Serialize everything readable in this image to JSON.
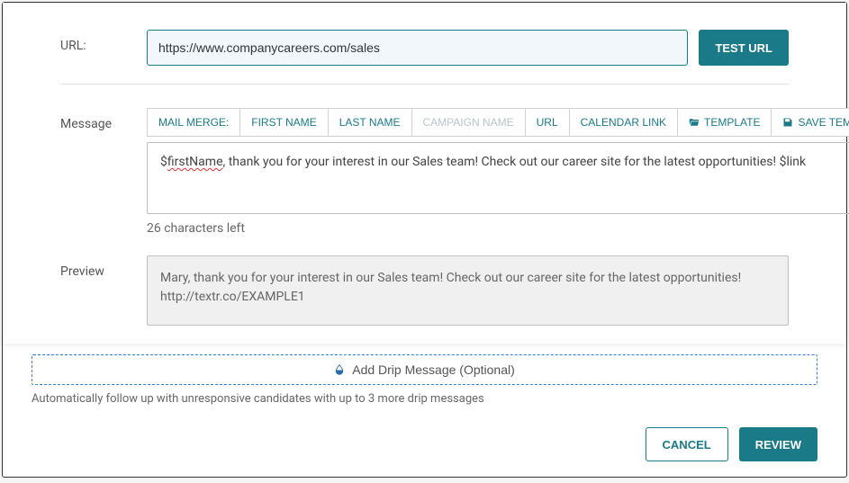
{
  "url": {
    "label": "URL:",
    "value": "https://www.companycareers.com/sales",
    "test_label": "TEST URL"
  },
  "message": {
    "label": "Message",
    "toolbar": {
      "mail_merge": "MAIL MERGE:",
      "first_name": "FIRST NAME",
      "last_name": "LAST NAME",
      "campaign_name": "CAMPAIGN NAME",
      "url": "URL",
      "calendar_link": "CALENDAR LINK",
      "template": "TEMPLATE",
      "save_template": "SAVE TEMPLATE"
    },
    "text_prefix": "$",
    "text_squiggle": "firstName",
    "text_suffix": ", thank you for your interest in our Sales team! Check out our career site for the latest opportunities! $link",
    "chars_left": "26 characters left"
  },
  "preview": {
    "label": "Preview",
    "text": "Mary, thank you for your interest in our Sales team! Check out our career site for the latest opportunities! http://textr.co/EXAMPLE1"
  },
  "drip": {
    "add_label": "Add Drip Message (Optional)",
    "note": "Automatically follow up with unresponsive candidates with up to 3 more drip messages"
  },
  "footer": {
    "cancel": "CANCEL",
    "review": "REVIEW"
  }
}
